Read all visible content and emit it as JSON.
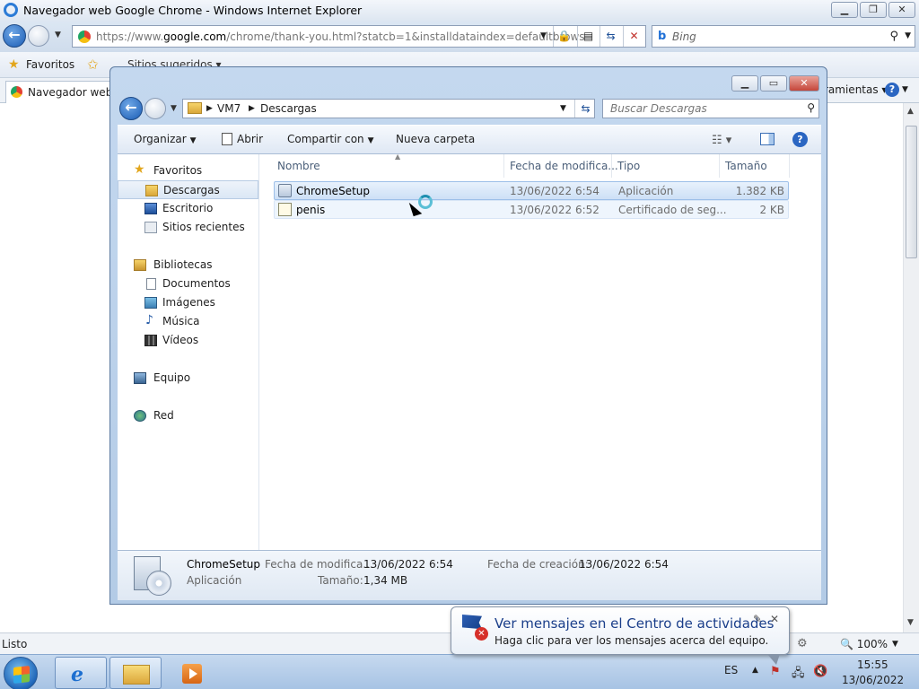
{
  "ie": {
    "title": "Navegador web Google Chrome - Windows Internet Explorer",
    "url_grey": "https://www.",
    "url_domain": "google.com",
    "url_rest": "/chrome/thank-you.html?statcb=1&installdataindex=defaultbrows",
    "search_placeholder": "Bing",
    "favorites_label": "Favoritos",
    "suggested_sites": "Sitios sugeridos ▾",
    "tab_label": "Navegador web Google Chrome",
    "tools_label": "ramientas ▾",
    "status_text": "Listo",
    "zoom": "100%"
  },
  "explorer": {
    "breadcrumb": [
      "VM7",
      "Descargas"
    ],
    "search_placeholder": "Buscar Descargas",
    "commands": {
      "organize": "Organizar",
      "open": "Abrir",
      "share": "Compartir con",
      "new_folder": "Nueva carpeta"
    },
    "nav": {
      "favorites": "Favoritos",
      "downloads": "Descargas",
      "desktop": "Escritorio",
      "recent": "Sitios recientes",
      "libraries": "Bibliotecas",
      "documents": "Documentos",
      "images": "Imágenes",
      "music": "Música",
      "videos": "Vídeos",
      "computer": "Equipo",
      "network": "Red"
    },
    "columns": {
      "name": "Nombre",
      "date": "Fecha de modifica...",
      "type": "Tipo",
      "size": "Tamaño"
    },
    "files": [
      {
        "name": "ChromeSetup",
        "date": "13/06/2022 6:54",
        "type": "Aplicación",
        "size": "1.382 KB"
      },
      {
        "name": "penis",
        "date": "13/06/2022 6:52",
        "type": "Certificado de seg...",
        "size": "2 KB"
      }
    ],
    "details": {
      "name": "ChromeSetup",
      "kind": "Aplicación",
      "modified_label": "Fecha de modifica...",
      "modified_value": "13/06/2022 6:54",
      "created_label": "Fecha de creación:",
      "created_value": "13/06/2022 6:54",
      "size_label": "Tamaño:",
      "size_value": "1,34 MB"
    }
  },
  "balloon": {
    "title": "Ver mensajes en el Centro de actividades",
    "body": "Haga clic para ver los mensajes acerca del equipo."
  },
  "taskbar": {
    "language": "ES",
    "time": "15:55",
    "date": "13/06/2022"
  },
  "colors": {
    "accent": "#2b66c2",
    "selection": "#cde0f6"
  }
}
